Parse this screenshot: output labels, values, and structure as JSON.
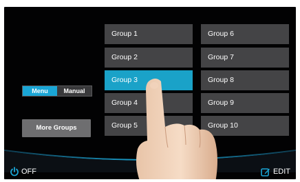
{
  "mode_toggle": {
    "options": [
      {
        "label": "Menu",
        "active": true
      },
      {
        "label": "Manual",
        "active": false
      }
    ]
  },
  "more_groups_label": "More Groups",
  "groups": [
    {
      "label": "Group 1",
      "selected": false
    },
    {
      "label": "Group 2",
      "selected": false
    },
    {
      "label": "Group 3",
      "selected": true
    },
    {
      "label": "Group 4",
      "selected": false
    },
    {
      "label": "Group 5",
      "selected": false
    },
    {
      "label": "Group 6",
      "selected": false
    },
    {
      "label": "Group 7",
      "selected": false
    },
    {
      "label": "Group 8",
      "selected": false
    },
    {
      "label": "Group 9",
      "selected": false
    },
    {
      "label": "Group 10",
      "selected": false
    }
  ],
  "footer": {
    "off_label": "OFF",
    "edit_label": "EDIT"
  },
  "colors": {
    "accent": "#1aa6d6",
    "button": "#444446",
    "background": "#020203"
  },
  "icons": {
    "power": "power-icon",
    "edit": "edit-icon"
  }
}
